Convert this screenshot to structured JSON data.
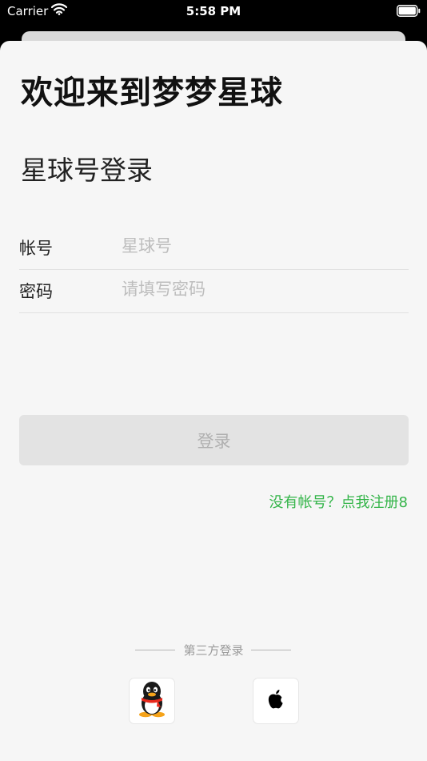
{
  "status_bar": {
    "carrier": "Carrier",
    "time": "5:58 PM"
  },
  "login": {
    "welcome_title": "欢迎来到梦梦星球",
    "subtitle": "星球号登录",
    "account_label": "帐号",
    "account_placeholder": "星球号",
    "account_value": "",
    "password_label": "密码",
    "password_placeholder": "请填写密码",
    "password_value": "",
    "login_button": "登录",
    "register_link": "没有帐号？点我注册8"
  },
  "third_party": {
    "label": "第三方登录",
    "providers": [
      {
        "name": "qq",
        "icon": "qq-penguin-icon"
      },
      {
        "name": "apple",
        "icon": "apple-icon"
      }
    ]
  },
  "colors": {
    "accent_green": "#35b54a",
    "sheet_background": "#f6f6f6",
    "button_disabled": "#e3e3e3",
    "placeholder": "#bdbdbd"
  }
}
